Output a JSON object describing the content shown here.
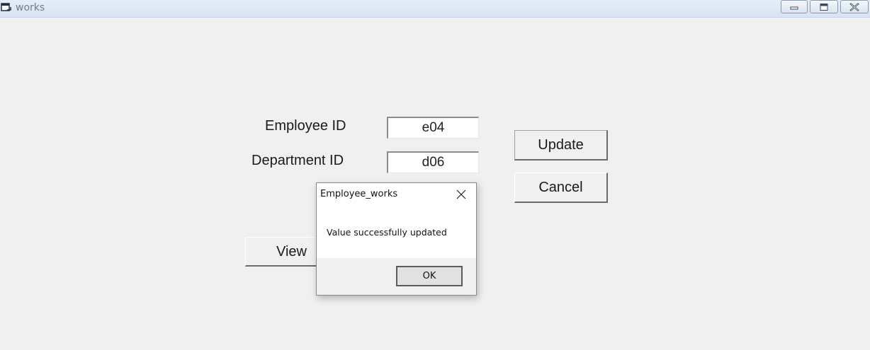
{
  "window": {
    "title": "works",
    "icon": "app-window-icon",
    "controls": [
      "minimize-icon",
      "maximize-icon",
      "close-icon"
    ]
  },
  "form": {
    "employee_id_label": "Employee ID",
    "employee_id_value": "e04",
    "department_id_label": "Department ID",
    "department_id_value": "d06",
    "update_label": "Update",
    "cancel_label": "Cancel",
    "view_label": "View"
  },
  "dialog": {
    "title": "Employee_works",
    "message": "Value successfully updated",
    "ok_label": "OK",
    "close_icon": "close-icon"
  }
}
